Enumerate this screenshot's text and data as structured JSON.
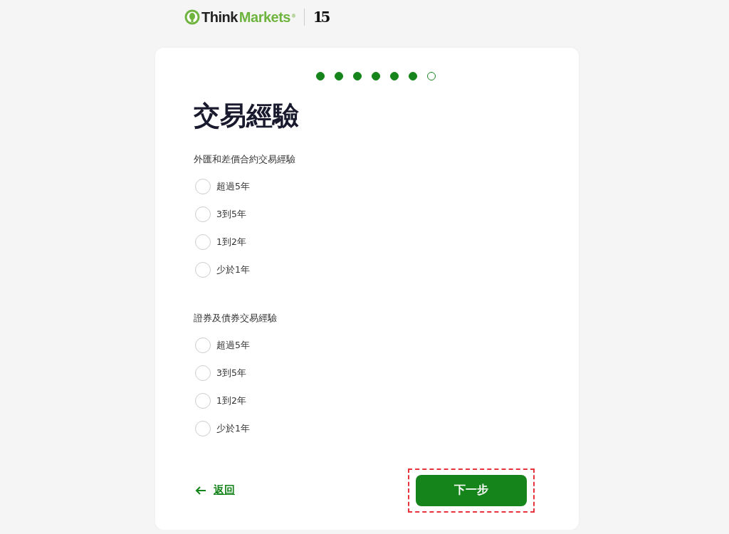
{
  "header": {
    "brand_part_1": "Think",
    "brand_part_2": "Markets",
    "registered_mark": "®",
    "anniversary_badge": "15"
  },
  "progress": {
    "steps": [
      {
        "completed": true
      },
      {
        "completed": true
      },
      {
        "completed": true
      },
      {
        "completed": true
      },
      {
        "completed": true
      },
      {
        "completed": true
      },
      {
        "completed": false
      }
    ]
  },
  "title": "交易經驗",
  "questions": [
    {
      "label": "外匯和差價合約交易經驗",
      "options": [
        {
          "label": "超過5年",
          "selected": false
        },
        {
          "label": "3到5年",
          "selected": false
        },
        {
          "label": "1到2年",
          "selected": false
        },
        {
          "label": "少於1年",
          "selected": false
        }
      ]
    },
    {
      "label": "證券及債券交易經驗",
      "options": [
        {
          "label": "超過5年",
          "selected": false
        },
        {
          "label": "3到5年",
          "selected": false
        },
        {
          "label": "1到2年",
          "selected": false
        },
        {
          "label": "少於1年",
          "selected": false
        }
      ]
    }
  ],
  "back_link": {
    "label": "返回"
  },
  "next_button": {
    "label": "下一步",
    "highlighted": true
  }
}
